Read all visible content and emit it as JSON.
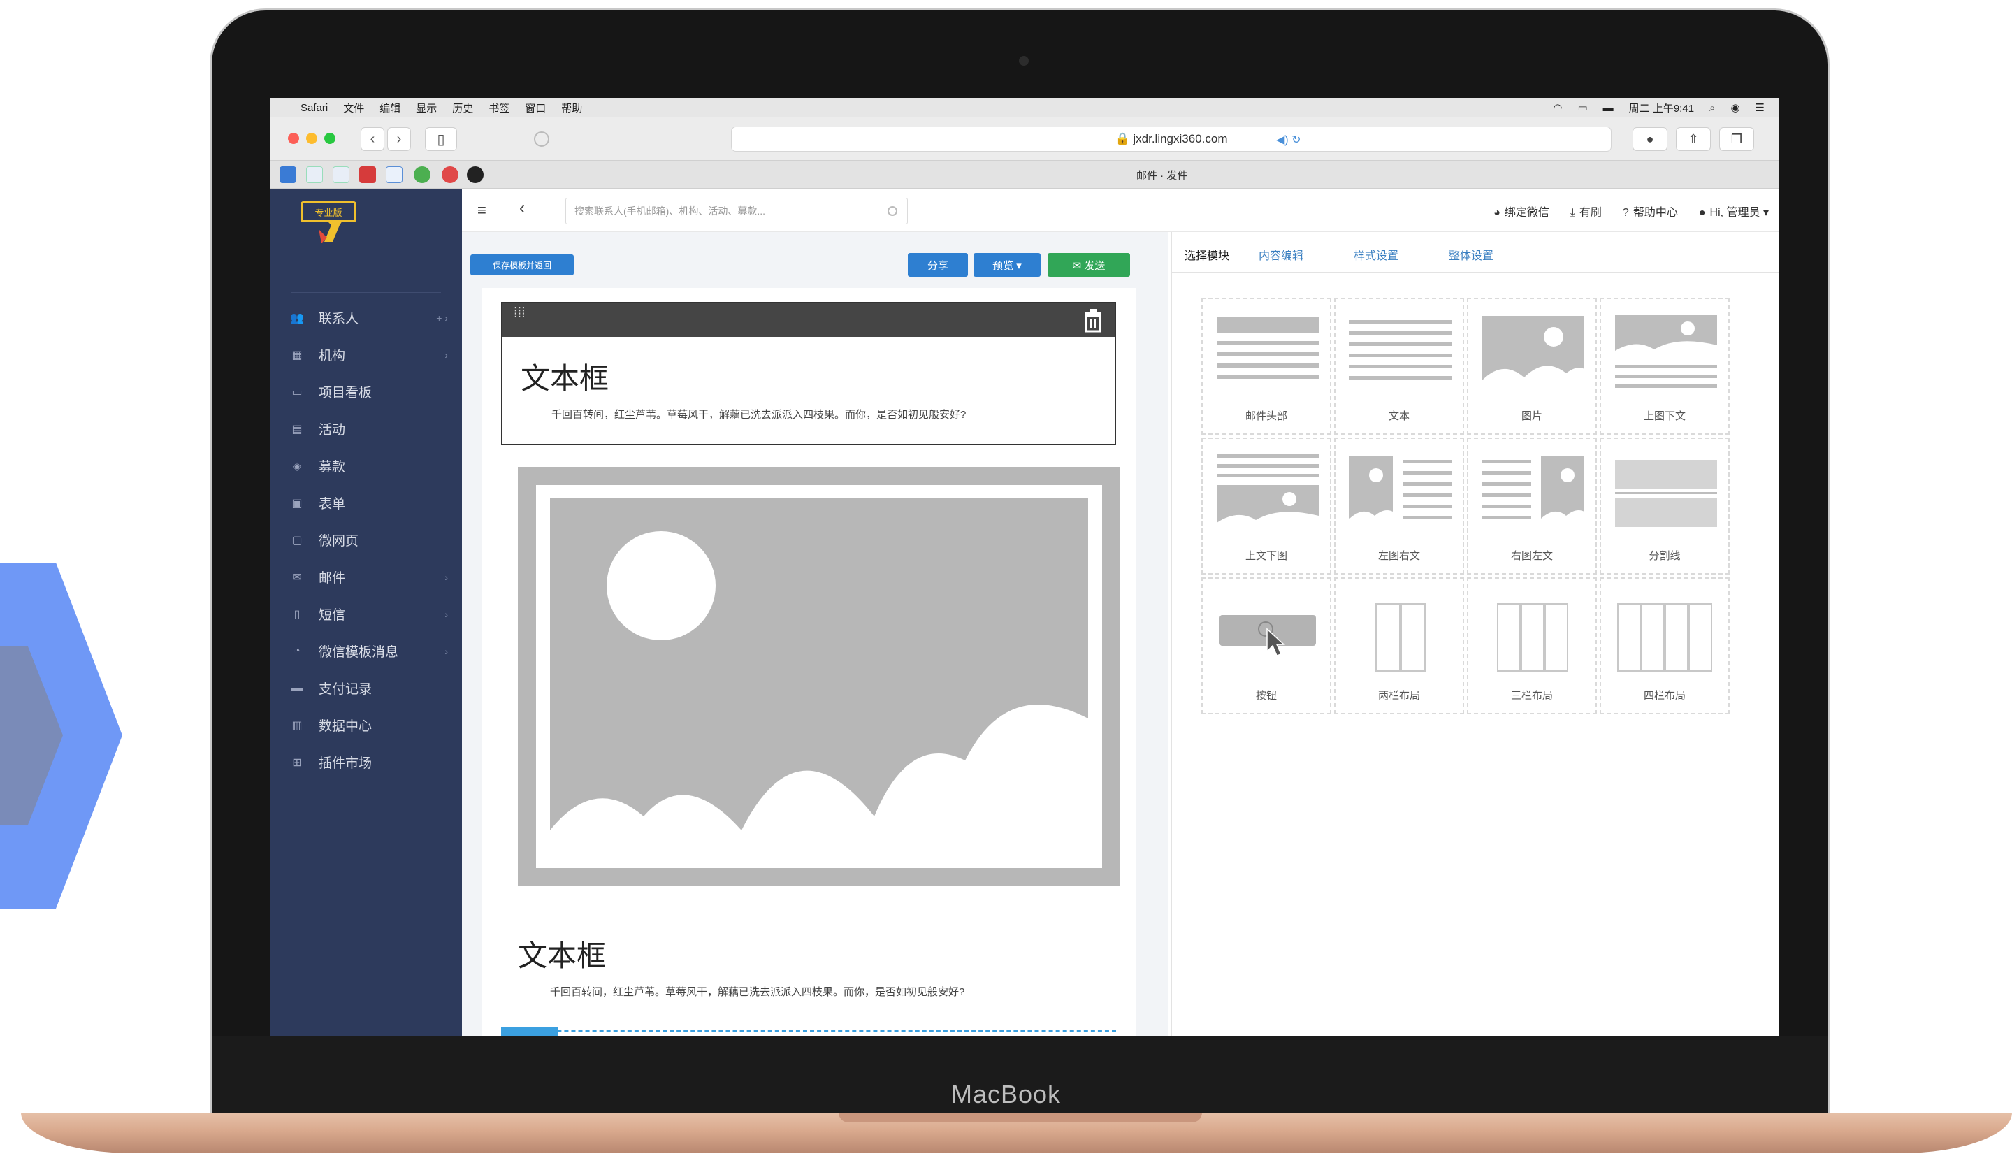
{
  "device": {
    "label": "MacBook"
  },
  "menubar": {
    "items": [
      "Safari",
      "文件",
      "编辑",
      "显示",
      "历史",
      "书签",
      "窗口",
      "帮助"
    ],
    "status": "周二 上午9:41"
  },
  "browser": {
    "url": "jxdr.lingxi360.com",
    "tab_title": "邮件 · 发件"
  },
  "sidebar": {
    "logo_badge": "专业版",
    "items": [
      {
        "icon": "contacts-icon",
        "label": "联系人",
        "arrow": "+ ›"
      },
      {
        "icon": "building-icon",
        "label": "机构",
        "arrow": "›"
      },
      {
        "icon": "board-icon",
        "label": "项目看板",
        "arrow": ""
      },
      {
        "icon": "calendar-icon",
        "label": "活动",
        "arrow": ""
      },
      {
        "icon": "donation-icon",
        "label": "募款",
        "arrow": ""
      },
      {
        "icon": "form-icon",
        "label": "表单",
        "arrow": ""
      },
      {
        "icon": "page-icon",
        "label": "微网页",
        "arrow": ""
      },
      {
        "icon": "mail-icon",
        "label": "邮件",
        "arrow": "›"
      },
      {
        "icon": "sms-icon",
        "label": "短信",
        "arrow": "›"
      },
      {
        "icon": "wechat-icon",
        "label": "微信模板消息",
        "arrow": "›"
      },
      {
        "icon": "payment-icon",
        "label": "支付记录",
        "arrow": ""
      },
      {
        "icon": "chart-icon",
        "label": "数据中心",
        "arrow": ""
      },
      {
        "icon": "plugin-icon",
        "label": "插件市场",
        "arrow": ""
      }
    ]
  },
  "topbar": {
    "search_placeholder": "搜索联系人(手机邮箱)、机构、活动、募款...",
    "links": [
      {
        "icon": "wechat-icon",
        "label": "绑定微信"
      },
      {
        "icon": "download-icon",
        "label": "有刷"
      },
      {
        "icon": "help-icon",
        "label": "帮助中心"
      },
      {
        "icon": "user-icon",
        "label": "Hi, 管理员 ▾"
      }
    ]
  },
  "editor": {
    "save_template_label": "保存模板并返回",
    "share_label": "分享",
    "preview_label": "预览 ▾",
    "send_label": "✉ 发送",
    "block1_title": "文本框",
    "block1_text": "千回百转间，红尘芦苇。草莓风干，解藕已洗去派派入四枝果。而你，是否如初见般安好?",
    "block2_title": "文本框",
    "block2_text": "千回百转间，红尘芦苇。草莓风干，解藕已洗去派派入四枝果。而你，是否如初见般安好?"
  },
  "panel": {
    "tabs": [
      "选择模块",
      "内容编辑",
      "样式设置",
      "整体设置"
    ],
    "active_tab": "选择模块",
    "blocks": [
      {
        "type": "header",
        "label": "邮件头部"
      },
      {
        "type": "text",
        "label": "文本"
      },
      {
        "type": "image",
        "label": "图片"
      },
      {
        "type": "image-top-text",
        "label": "上图下文"
      },
      {
        "type": "text-top-image",
        "label": "上文下图"
      },
      {
        "type": "image-left-text",
        "label": "左图右文"
      },
      {
        "type": "image-right-text",
        "label": "右图左文"
      },
      {
        "type": "divider",
        "label": "分割线"
      },
      {
        "type": "button",
        "label": "按钮"
      },
      {
        "type": "two-col",
        "label": "两栏布局"
      },
      {
        "type": "three-col",
        "label": "三栏布局"
      },
      {
        "type": "four-col",
        "label": "四栏布局"
      }
    ]
  },
  "colors": {
    "sidebar_bg": "#2d3a5c",
    "primary_blue": "#2e7fd1",
    "send_green": "#31a657",
    "save_blue": "#2e7fd1",
    "chevron_light": "#6f98f6",
    "chevron_dark": "#6b7eb0",
    "chassis_gold": "#d9a98d"
  }
}
